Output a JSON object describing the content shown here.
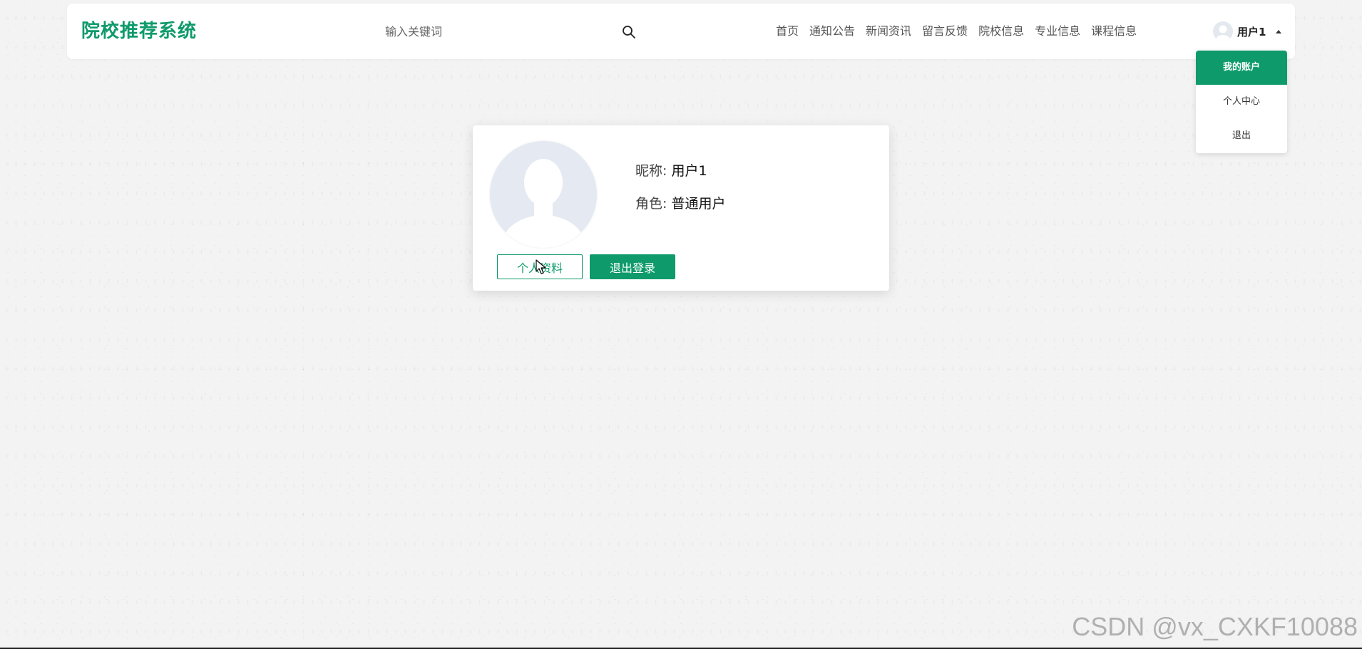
{
  "header": {
    "logo": "院校推荐系统",
    "search_placeholder": "输入关键词",
    "nav": [
      "首页",
      "通知公告",
      "新闻资讯",
      "留言反馈",
      "院校信息",
      "专业信息",
      "课程信息"
    ],
    "user_name": "用户1"
  },
  "dropdown": {
    "items": [
      "我的账户",
      "个人中心",
      "退出"
    ],
    "active_index": 0
  },
  "profile": {
    "nickname_label": "昵称:",
    "nickname": "用户1",
    "role_label": "角色:",
    "role": "普通用户",
    "profile_button": "个人资料",
    "logout_button": "退出登录"
  },
  "watermark": "CSDN @vx_CXKF10088",
  "colors": {
    "accent": "#0e9a6b"
  }
}
